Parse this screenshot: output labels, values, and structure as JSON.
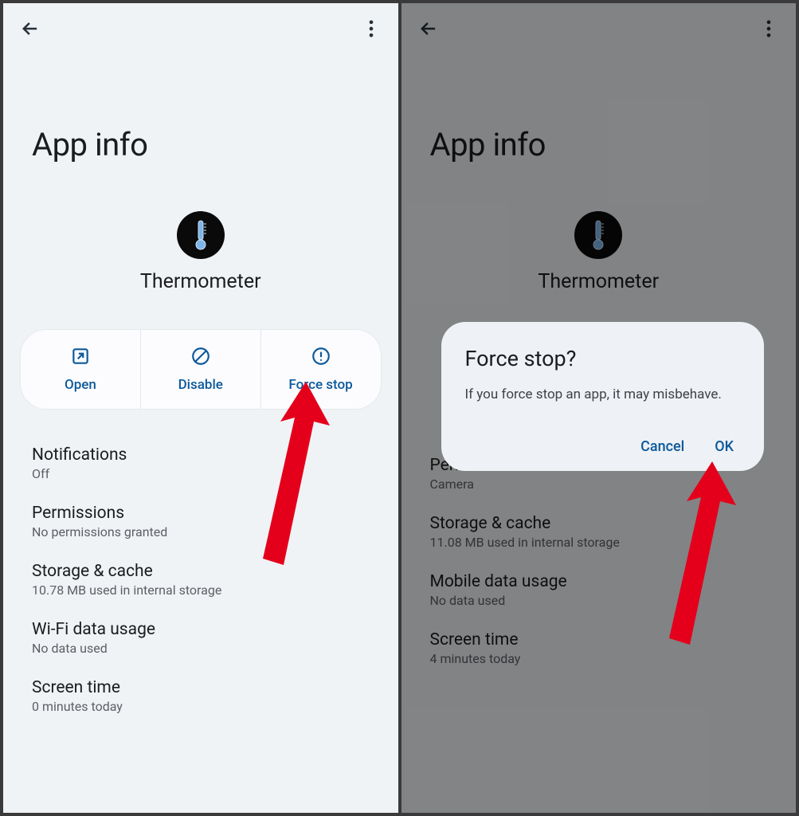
{
  "left": {
    "page_title": "App info",
    "app_name": "Thermometer",
    "actions": {
      "open": "Open",
      "disable": "Disable",
      "force_stop": "Force stop"
    },
    "settings": [
      {
        "title": "Notifications",
        "sub": "Off"
      },
      {
        "title": "Permissions",
        "sub": "No permissions granted"
      },
      {
        "title": "Storage & cache",
        "sub": "10.78 MB used in internal storage"
      },
      {
        "title": "Wi-Fi data usage",
        "sub": "No data used"
      },
      {
        "title": "Screen time",
        "sub": "0 minutes today"
      }
    ]
  },
  "right": {
    "page_title": "App info",
    "app_name": "Thermometer",
    "settings": [
      {
        "title": "Permissions",
        "sub": "Camera"
      },
      {
        "title": "Storage & cache",
        "sub": "11.08 MB used in internal storage"
      },
      {
        "title": "Mobile data usage",
        "sub": "No data used"
      },
      {
        "title": "Screen time",
        "sub": "4 minutes today"
      }
    ],
    "dialog": {
      "title": "Force stop?",
      "body": "If you force stop an app, it may misbehave.",
      "cancel": "Cancel",
      "ok": "OK"
    }
  }
}
